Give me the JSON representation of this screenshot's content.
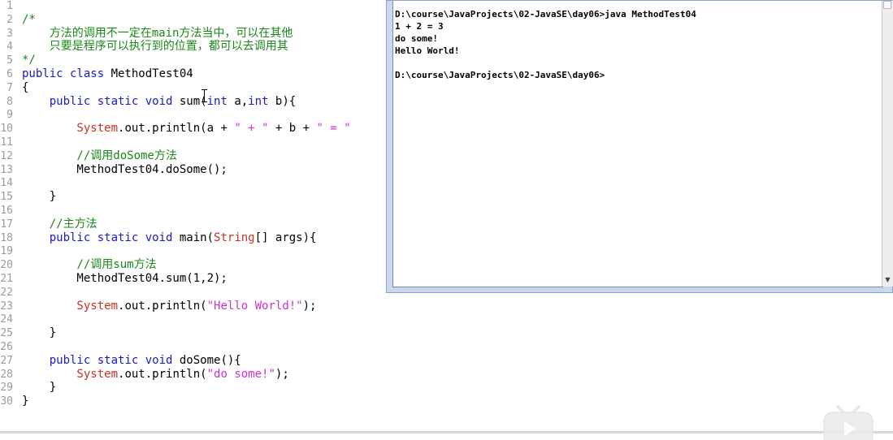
{
  "editor": {
    "lines": [
      {
        "num": "1",
        "tokens": []
      },
      {
        "num": "2",
        "tokens": [
          {
            "t": "/*",
            "c": "cm"
          }
        ]
      },
      {
        "num": "3",
        "tokens": [
          {
            "t": "    方法的调用不一定在main方法当中，可以在其他",
            "c": "cm"
          }
        ]
      },
      {
        "num": "4",
        "tokens": [
          {
            "t": "    只要是程序可以执行到的位置，都可以去调用其",
            "c": "cm"
          }
        ]
      },
      {
        "num": "5",
        "tokens": [
          {
            "t": "*/",
            "c": "cm"
          }
        ]
      },
      {
        "num": "6",
        "tokens": [
          {
            "t": "public class ",
            "c": "kw"
          },
          {
            "t": "MethodTest04",
            "c": "pl"
          }
        ]
      },
      {
        "num": "7",
        "tokens": [
          {
            "t": "{",
            "c": "pl"
          }
        ]
      },
      {
        "num": "8",
        "tokens": [
          {
            "t": "    public static void ",
            "c": "kw"
          },
          {
            "t": "sum(",
            "c": "pl"
          },
          {
            "t": "int ",
            "c": "kw"
          },
          {
            "t": "a,",
            "c": "pl"
          },
          {
            "t": "int ",
            "c": "kw"
          },
          {
            "t": "b){",
            "c": "pl"
          }
        ]
      },
      {
        "num": "9",
        "tokens": []
      },
      {
        "num": "10",
        "tokens": [
          {
            "t": "        System",
            "c": "cls"
          },
          {
            "t": ".out.println(a + ",
            "c": "pl"
          },
          {
            "t": "\" + \"",
            "c": "str"
          },
          {
            "t": " + b + ",
            "c": "pl"
          },
          {
            "t": "\" = \"",
            "c": "str"
          }
        ]
      },
      {
        "num": "11",
        "tokens": []
      },
      {
        "num": "12",
        "tokens": [
          {
            "t": "        //调用doSome方法",
            "c": "cm"
          }
        ]
      },
      {
        "num": "13",
        "tokens": [
          {
            "t": "        MethodTest04.doSome();",
            "c": "pl"
          }
        ]
      },
      {
        "num": "14",
        "tokens": []
      },
      {
        "num": "15",
        "tokens": [
          {
            "t": "    }",
            "c": "pl"
          }
        ]
      },
      {
        "num": "16",
        "tokens": []
      },
      {
        "num": "17",
        "tokens": [
          {
            "t": "    //主方法",
            "c": "cm"
          }
        ]
      },
      {
        "num": "18",
        "tokens": [
          {
            "t": "    public static void ",
            "c": "kw"
          },
          {
            "t": "main(",
            "c": "pl"
          },
          {
            "t": "String",
            "c": "cls"
          },
          {
            "t": "[] args){",
            "c": "pl"
          }
        ]
      },
      {
        "num": "19",
        "tokens": []
      },
      {
        "num": "20",
        "tokens": [
          {
            "t": "        //调用sum方法",
            "c": "cm"
          }
        ]
      },
      {
        "num": "21",
        "tokens": [
          {
            "t": "        MethodTest04.sum(1,2);",
            "c": "pl"
          }
        ]
      },
      {
        "num": "22",
        "tokens": []
      },
      {
        "num": "23",
        "tokens": [
          {
            "t": "        System",
            "c": "cls"
          },
          {
            "t": ".out.println(",
            "c": "pl"
          },
          {
            "t": "\"Hello World!\"",
            "c": "str"
          },
          {
            "t": ");",
            "c": "pl"
          }
        ]
      },
      {
        "num": "24",
        "tokens": []
      },
      {
        "num": "25",
        "tokens": [
          {
            "t": "    }",
            "c": "pl"
          }
        ]
      },
      {
        "num": "26",
        "tokens": []
      },
      {
        "num": "27",
        "tokens": [
          {
            "t": "    public static void ",
            "c": "kw"
          },
          {
            "t": "doSome(){",
            "c": "pl"
          }
        ]
      },
      {
        "num": "28",
        "tokens": [
          {
            "t": "        System",
            "c": "cls"
          },
          {
            "t": ".out.println(",
            "c": "pl"
          },
          {
            "t": "\"do some!\"",
            "c": "str"
          },
          {
            "t": ");",
            "c": "pl"
          }
        ]
      },
      {
        "num": "29",
        "tokens": [
          {
            "t": "    }",
            "c": "pl"
          }
        ]
      },
      {
        "num": "30",
        "tokens": [
          {
            "t": "}",
            "c": "pl"
          }
        ]
      }
    ]
  },
  "console": {
    "lines": [
      "D:\\course\\JavaProjects\\02-JavaSE\\day06>java MethodTest04",
      "1 + 2 = 3",
      "do some!",
      "Hello World!",
      "",
      "D:\\course\\JavaProjects\\02-JavaSE\\day06>"
    ]
  },
  "icons": {
    "scroll_up": "scroll-up-arrow-icon",
    "scroll_down": "scroll-down-arrow-icon",
    "watermark": "bilibili-tv-logo-icon"
  },
  "colors": {
    "keyword": "#1818c8",
    "comment": "#188818",
    "string": "#d030d0",
    "class": "#c83020",
    "console_frame": "#c9d8ea"
  }
}
